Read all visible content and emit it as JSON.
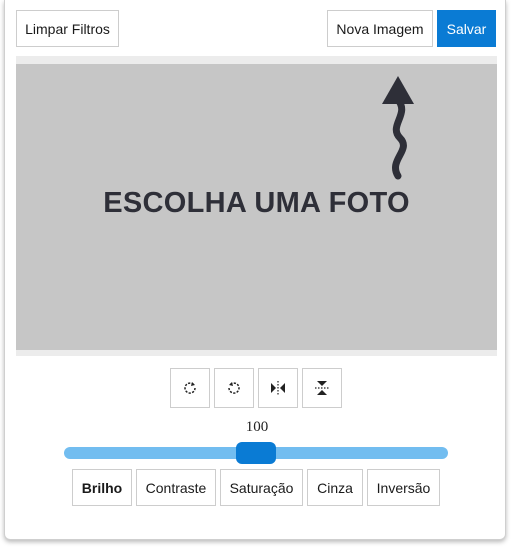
{
  "toolbar": {
    "clear_filters": "Limpar Filtros",
    "new_image": "Nova Imagem",
    "save": "Salvar"
  },
  "preview": {
    "placeholder": "ESCOLHA UMA FOTO",
    "arrow_icon": "wavy-up-arrow"
  },
  "transform_tools": [
    {
      "name": "rotate-left",
      "icon": "rotate-left-icon"
    },
    {
      "name": "rotate-right",
      "icon": "rotate-right-icon"
    },
    {
      "name": "flip-horizontal",
      "icon": "flip-horizontal-icon"
    },
    {
      "name": "flip-vertical",
      "icon": "flip-vertical-icon"
    }
  ],
  "slider": {
    "value": "100",
    "fraction": 0.5
  },
  "filters": {
    "items": [
      "Brilho",
      "Contraste",
      "Saturação",
      "Cinza",
      "Inversão"
    ],
    "active": "Brilho"
  },
  "colors": {
    "primary": "#0a7bd4",
    "track": "#72bdf0",
    "placeholder_bg": "#c6c6c6",
    "placeholder_text": "#2e2f38"
  }
}
